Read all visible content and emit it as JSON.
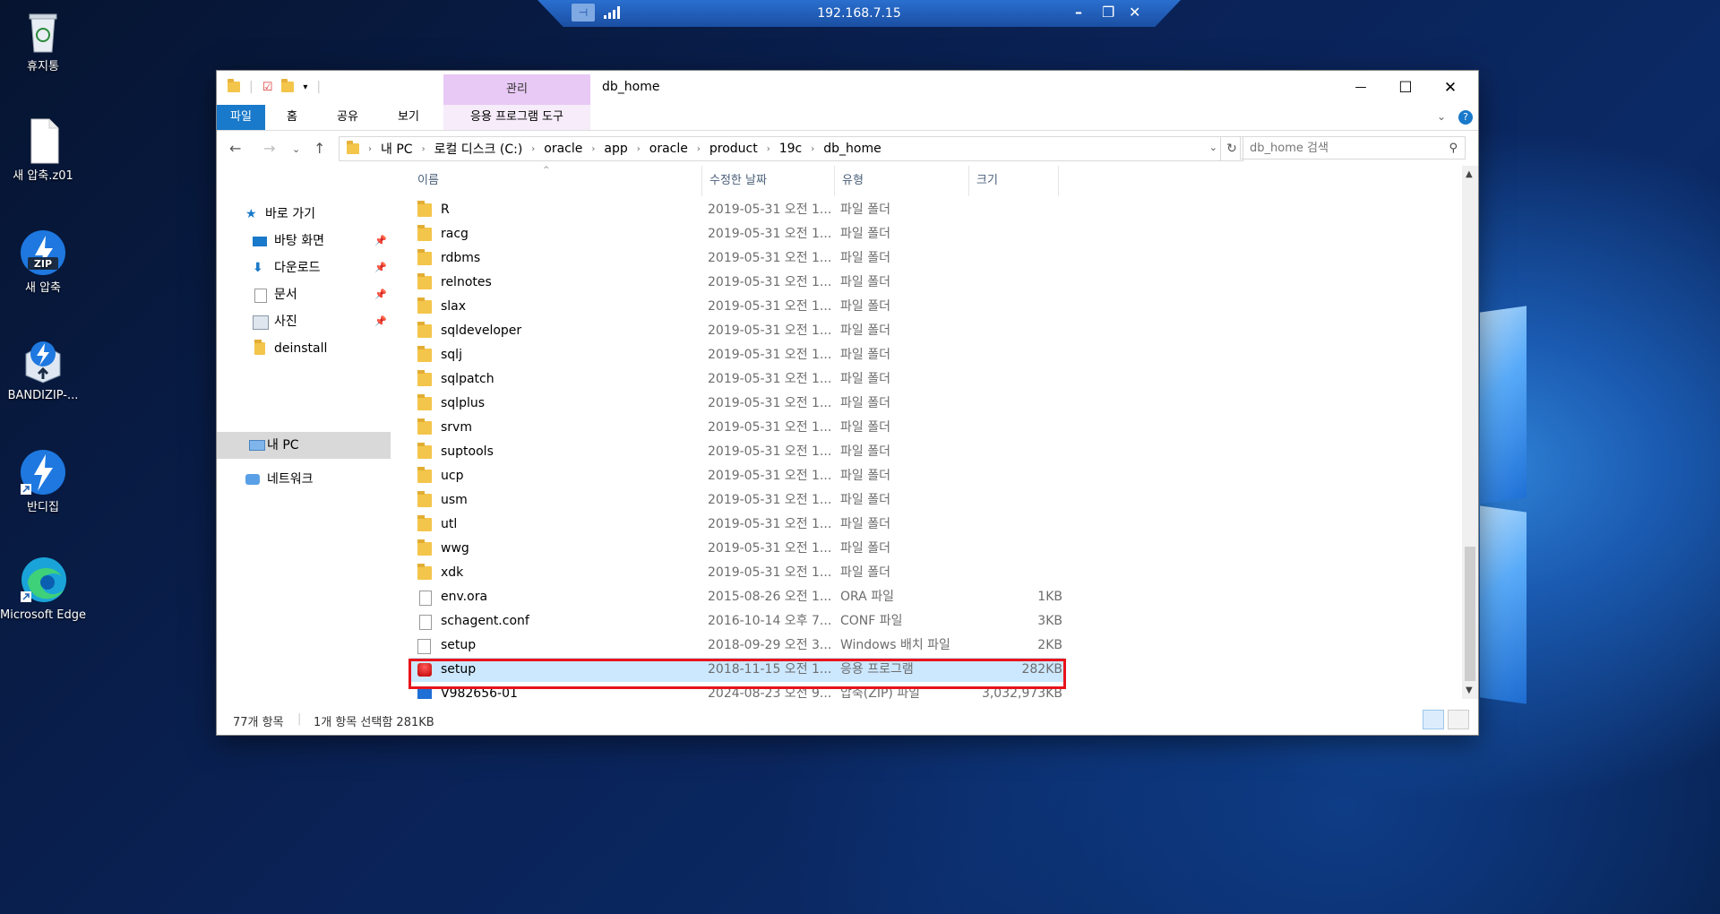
{
  "remote_bar": {
    "ip": "192.168.7.15"
  },
  "desktop_icons": [
    {
      "label": "휴지통"
    },
    {
      "label": "새 압축.z01"
    },
    {
      "label": "새 압축",
      "badge": "ZIP"
    },
    {
      "label": "BANDIZIP-..."
    },
    {
      "label": "반디집"
    },
    {
      "label": "Microsoft Edge"
    }
  ],
  "window": {
    "title": "db_home",
    "context_tab": "관리",
    "ribbon_tabs": [
      "파일",
      "홈",
      "공유",
      "보기",
      "응용 프로그램 도구"
    ],
    "controls": {
      "minimize": "—",
      "maximize": "☐",
      "close": "✕"
    }
  },
  "address": {
    "segments": [
      "내 PC",
      "로컬 디스크 (C:)",
      "oracle",
      "app",
      "oracle",
      "product",
      "19c",
      "db_home"
    ],
    "search_placeholder": "db_home 검색"
  },
  "nav_pane": {
    "quick_access": "바로 가기",
    "pinned": [
      {
        "label": "바탕 화면",
        "icon": "desktop-icon"
      },
      {
        "label": "다운로드",
        "icon": "download-icon"
      },
      {
        "label": "문서",
        "icon": "document-icon"
      },
      {
        "label": "사진",
        "icon": "picture-icon"
      }
    ],
    "recent": "deinstall",
    "this_pc": "내 PC",
    "network": "네트워크"
  },
  "columns": {
    "name": "이름",
    "date": "수정한 날짜",
    "type": "유형",
    "size": "크기"
  },
  "files": [
    {
      "name": "R",
      "date": "2019-05-31 오전 1...",
      "type": "파일 폴더",
      "size": "",
      "icon": "folder"
    },
    {
      "name": "racg",
      "date": "2019-05-31 오전 1...",
      "type": "파일 폴더",
      "size": "",
      "icon": "folder"
    },
    {
      "name": "rdbms",
      "date": "2019-05-31 오전 1...",
      "type": "파일 폴더",
      "size": "",
      "icon": "folder"
    },
    {
      "name": "relnotes",
      "date": "2019-05-31 오전 1...",
      "type": "파일 폴더",
      "size": "",
      "icon": "folder"
    },
    {
      "name": "slax",
      "date": "2019-05-31 오전 1...",
      "type": "파일 폴더",
      "size": "",
      "icon": "folder"
    },
    {
      "name": "sqldeveloper",
      "date": "2019-05-31 오전 1...",
      "type": "파일 폴더",
      "size": "",
      "icon": "folder"
    },
    {
      "name": "sqlj",
      "date": "2019-05-31 오전 1...",
      "type": "파일 폴더",
      "size": "",
      "icon": "folder"
    },
    {
      "name": "sqlpatch",
      "date": "2019-05-31 오전 1...",
      "type": "파일 폴더",
      "size": "",
      "icon": "folder"
    },
    {
      "name": "sqlplus",
      "date": "2019-05-31 오전 1...",
      "type": "파일 폴더",
      "size": "",
      "icon": "folder"
    },
    {
      "name": "srvm",
      "date": "2019-05-31 오전 1...",
      "type": "파일 폴더",
      "size": "",
      "icon": "folder"
    },
    {
      "name": "suptools",
      "date": "2019-05-31 오전 1...",
      "type": "파일 폴더",
      "size": "",
      "icon": "folder"
    },
    {
      "name": "ucp",
      "date": "2019-05-31 오전 1...",
      "type": "파일 폴더",
      "size": "",
      "icon": "folder"
    },
    {
      "name": "usm",
      "date": "2019-05-31 오전 1...",
      "type": "파일 폴더",
      "size": "",
      "icon": "folder"
    },
    {
      "name": "utl",
      "date": "2019-05-31 오전 1...",
      "type": "파일 폴더",
      "size": "",
      "icon": "folder"
    },
    {
      "name": "wwg",
      "date": "2019-05-31 오전 1...",
      "type": "파일 폴더",
      "size": "",
      "icon": "folder"
    },
    {
      "name": "xdk",
      "date": "2019-05-31 오전 1...",
      "type": "파일 폴더",
      "size": "",
      "icon": "folder"
    },
    {
      "name": "env.ora",
      "date": "2015-08-26 오전 1...",
      "type": "ORA 파일",
      "size": "1KB",
      "icon": "file"
    },
    {
      "name": "schagent.conf",
      "date": "2016-10-14 오후 7...",
      "type": "CONF 파일",
      "size": "3KB",
      "icon": "file"
    },
    {
      "name": "setup",
      "date": "2018-09-29 오전 3...",
      "type": "Windows 배치 파일",
      "size": "2KB",
      "icon": "bat"
    },
    {
      "name": "setup",
      "date": "2018-11-15 오전 1...",
      "type": "응용 프로그램",
      "size": "282KB",
      "icon": "app",
      "selected": true
    },
    {
      "name": "V982656-01",
      "date": "2024-08-23 오전 9...",
      "type": "압축(ZIP) 파일",
      "size": "3,032,973KB",
      "icon": "zip"
    }
  ],
  "status": {
    "count": "77개 항목",
    "selection": "1개 항목 선택함 281KB"
  },
  "colors": {
    "ribbon_file": "#1979ca",
    "context_tab": "#e8c8f4",
    "selected_row": "#cce8ff",
    "highlight": "#e8141b"
  }
}
